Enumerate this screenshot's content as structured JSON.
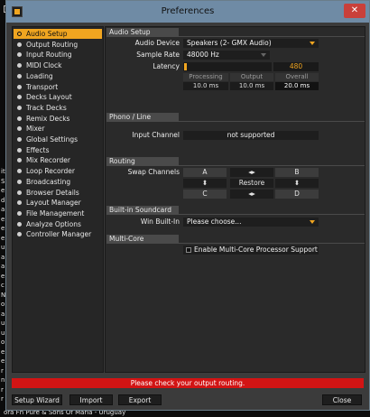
{
  "background_app": {
    "left_strip_chars": [
      "it",
      "S",
      "e",
      "d",
      "a",
      "e",
      "e",
      "e",
      "u",
      "a",
      "a",
      "e",
      "c",
      "N",
      "o",
      "a",
      "u",
      "u",
      "o",
      "e",
      "e",
      "r",
      "n",
      "r",
      "r"
    ],
    "bottom_text": "ora Fn Pure & Sons Of Maria - Uruguay"
  },
  "window": {
    "title": "Preferences",
    "close_glyph": "✕"
  },
  "nav": {
    "items": [
      {
        "label": "Audio Setup",
        "active": true
      },
      {
        "label": "Output Routing"
      },
      {
        "label": "Input Routing"
      },
      {
        "label": "MIDI Clock"
      },
      {
        "label": "Loading"
      },
      {
        "label": "Transport"
      },
      {
        "label": "Decks Layout"
      },
      {
        "label": "Track Decks"
      },
      {
        "label": "Remix Decks"
      },
      {
        "label": "Mixer"
      },
      {
        "label": "Global Settings"
      },
      {
        "label": "Effects"
      },
      {
        "label": "Mix Recorder"
      },
      {
        "label": "Loop Recorder"
      },
      {
        "label": "Broadcasting"
      },
      {
        "label": "Browser Details"
      },
      {
        "label": "Layout Manager"
      },
      {
        "label": "File Management"
      },
      {
        "label": "Analyze Options"
      },
      {
        "label": "Controller Manager"
      }
    ]
  },
  "audio_setup": {
    "heading": "Audio Setup",
    "device_label": "Audio Device",
    "device_value": "Speakers (2- GMX Audio)",
    "rate_label": "Sample Rate",
    "rate_value": "48000 Hz",
    "latency_label": "Latency",
    "latency_samples": "480",
    "latency_fill_fraction": 0.02,
    "processing_label": "Processing",
    "output_label": "Output",
    "overall_label": "Overall",
    "processing_value": "10.0 ms",
    "output_value": "10.0 ms",
    "overall_value": "20.0 ms"
  },
  "phono_line": {
    "heading": "Phono / Line",
    "input_label": "Input Channel",
    "input_value": "not supported"
  },
  "routing": {
    "heading": "Routing",
    "swap_label": "Swap Channels",
    "a": "A",
    "b": "B",
    "c": "C",
    "d": "D",
    "restore": "Restore",
    "swap_h": "◂▸",
    "swap_v": "⬍"
  },
  "soundcard": {
    "heading": "Built-in Soundcard",
    "win_label": "Win Built-In",
    "win_value": "Please choose..."
  },
  "multicore": {
    "heading": "Multi-Core",
    "checkbox_label": "Enable Multi-Core Processor Support",
    "checked": false
  },
  "status_message": "Please check your output routing.",
  "footer": {
    "setup_wizard": "Setup Wizard",
    "import": "Import",
    "export": "Export",
    "close": "Close"
  },
  "colors": {
    "accent": "#f0a520",
    "titlebar": "#6f8ba5",
    "close_button": "#c9403a",
    "status_error": "#d21414"
  }
}
